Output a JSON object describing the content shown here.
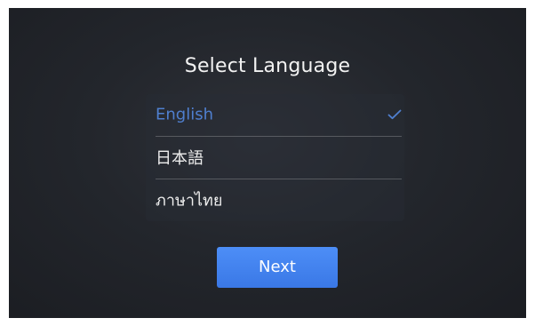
{
  "screen": {
    "title": "Select Language"
  },
  "languages": {
    "items": [
      {
        "label": "English",
        "selected": true
      },
      {
        "label": "日本語",
        "selected": false
      },
      {
        "label": "ภาษาไทย",
        "selected": false
      }
    ]
  },
  "actions": {
    "next_label": "Next"
  },
  "colors": {
    "background": "#23262c",
    "selected_text": "#4f7fcf",
    "accent_button": "#4d8ef7",
    "text": "#eeeeee"
  },
  "icons": {
    "selected_marker": "check-icon"
  }
}
